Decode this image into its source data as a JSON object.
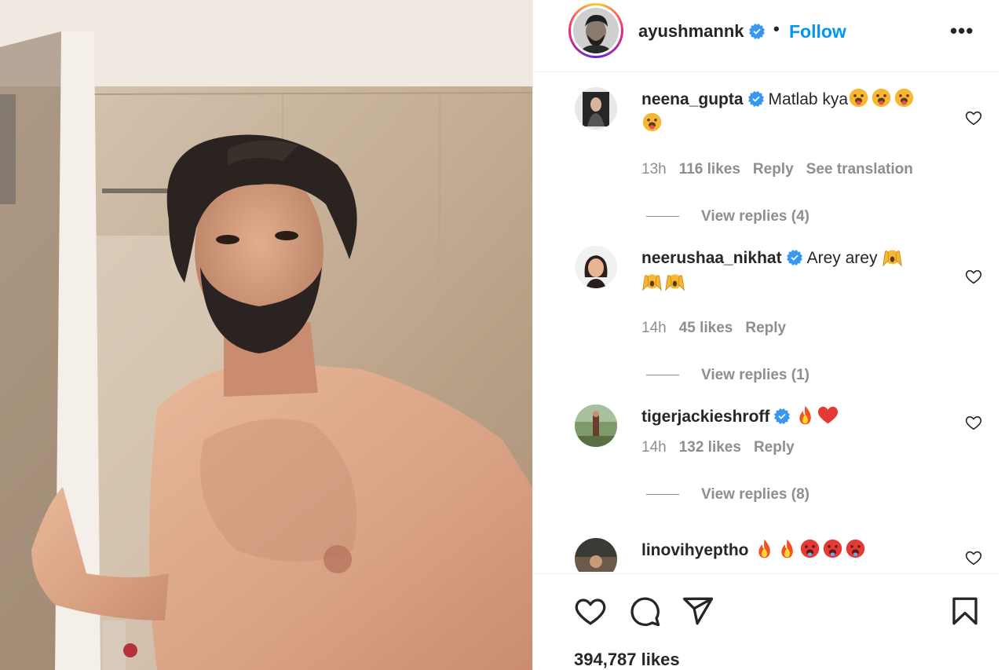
{
  "post": {
    "author": {
      "username": "ayushmannk",
      "verified": true,
      "separator": "•",
      "follow_label": "Follow",
      "more_icon": "more-options-icon",
      "more_label": "•••"
    },
    "likes_label": "394,787 likes"
  },
  "comments": [
    {
      "username": "neena_gupta",
      "verified": true,
      "text": "Matlab kya",
      "emojis": [
        "tongue-face",
        "tongue-face",
        "tongue-face",
        "tongue-face"
      ],
      "time": "13h",
      "likes": "116 likes",
      "reply_label": "Reply",
      "translation_label": "See translation",
      "view_replies": "View replies (4)"
    },
    {
      "username": "neerushaa_nikhat",
      "verified": true,
      "text": "Arey arey",
      "emojis": [
        "screaming-hands",
        "screaming-hands",
        "screaming-hands"
      ],
      "time": "14h",
      "likes": "45 likes",
      "reply_label": "Reply",
      "view_replies": "View replies (1)"
    },
    {
      "username": "tigerjackieshroff",
      "verified": true,
      "text": "",
      "emojis": [
        "fire",
        "red-heart"
      ],
      "time": "14h",
      "likes": "132 likes",
      "reply_label": "Reply",
      "view_replies": "View replies (8)"
    },
    {
      "username": "linovihyeptho",
      "verified": false,
      "text": "",
      "emojis": [
        "fire",
        "fire",
        "hot-face",
        "hot-face",
        "hot-face"
      ]
    }
  ],
  "action_icons": [
    "heart-icon",
    "comment-icon",
    "share-icon",
    "bookmark-icon"
  ],
  "colors": {
    "link_blue": "#0095f6",
    "verified_blue": "#3897f0",
    "muted_text": "#8e8e8e",
    "primary_text": "#262626",
    "heart_red": "#ed4956"
  }
}
